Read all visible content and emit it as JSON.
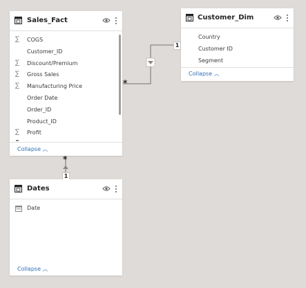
{
  "tables": {
    "sales_fact": {
      "title": "Sales_Fact",
      "fields": [
        {
          "label": "COGS",
          "icon": "sigma-icon",
          "sigma": "∑"
        },
        {
          "label": "Customer_ID",
          "icon": "",
          "sigma": ""
        },
        {
          "label": "Discount/Premium",
          "icon": "sigma-icon",
          "sigma": "∑"
        },
        {
          "label": "Gross Sales",
          "icon": "sigma-icon",
          "sigma": "∑"
        },
        {
          "label": "Manufacturing Price",
          "icon": "sigma-icon",
          "sigma": "∑"
        },
        {
          "label": "Order Date",
          "icon": "",
          "sigma": ""
        },
        {
          "label": "Order_ID",
          "icon": "",
          "sigma": ""
        },
        {
          "label": "Product_ID",
          "icon": "",
          "sigma": ""
        },
        {
          "label": "Profit",
          "icon": "sigma-icon",
          "sigma": "∑"
        }
      ],
      "collapse_label": "Collapse"
    },
    "customer_dim": {
      "title": "Customer_Dim",
      "fields": [
        {
          "label": "Country"
        },
        {
          "label": "Customer ID"
        },
        {
          "label": "Segment"
        }
      ],
      "collapse_label": "Collapse"
    },
    "dates": {
      "title": "Dates",
      "fields": [
        {
          "label": "Date",
          "icon": "calendar-icon"
        }
      ],
      "collapse_label": "Collapse"
    }
  },
  "relationships": {
    "sales_to_customer": {
      "many_label": "*",
      "one_label": "1",
      "direction": "single"
    },
    "sales_to_dates": {
      "many_label": "*",
      "one_label": "1",
      "direction": "single"
    }
  },
  "symbols": {
    "collapse_chevron": "︿"
  },
  "colors": {
    "canvas": "#dedbd8",
    "card": "#ffffff",
    "link": "#2f6fb5",
    "line": "#8a8886"
  }
}
